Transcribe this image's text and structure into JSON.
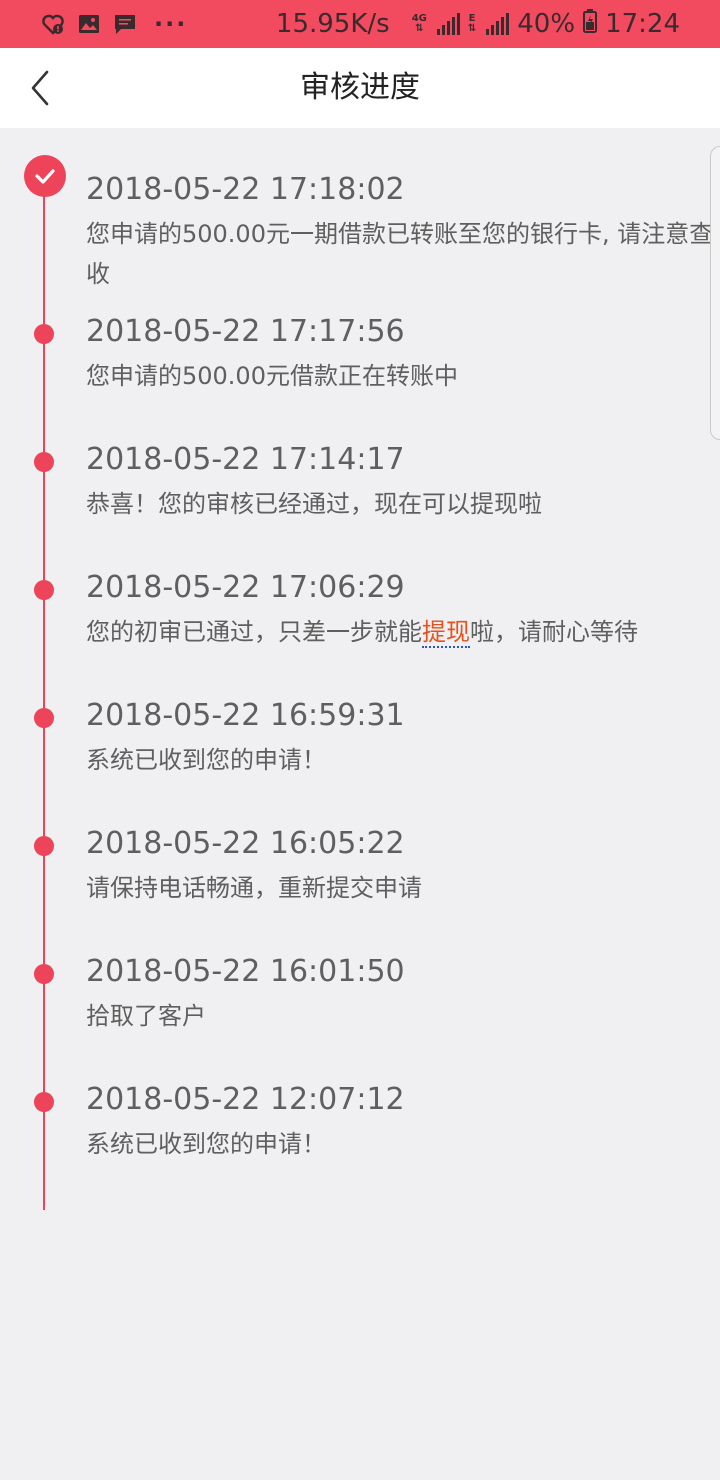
{
  "status_bar": {
    "net_speed": "15.95K/s",
    "net_label_1": "4G",
    "net_label_2": "E",
    "battery": "40%",
    "time": "17:24",
    "dots": "···"
  },
  "header": {
    "title": "审核进度",
    "back_icon": "chevron-left-icon"
  },
  "timeline": {
    "items": [
      {
        "time": "2018-05-22 17:18:02",
        "message": "您申请的500.00元一期借款已转账至您的银行卡, 请注意查收",
        "marker": "check"
      },
      {
        "time": "2018-05-22 17:17:56",
        "message": "您申请的500.00元借款正在转账中",
        "marker": "dot"
      },
      {
        "time": "2018-05-22 17:14:17",
        "message": "恭喜！您的审核已经通过，现在可以提现啦",
        "marker": "dot"
      },
      {
        "time": "2018-05-22 17:06:29",
        "message_before": "您的初审已通过，只差一步就能",
        "message_highlight": "提现",
        "message_after": "啦，请耐心等待",
        "marker": "dot"
      },
      {
        "time": "2018-05-22 16:59:31",
        "message": "系统已收到您的申请！",
        "marker": "dot"
      },
      {
        "time": "2018-05-22 16:05:22",
        "message": "请保持电话畅通，重新提交申请",
        "marker": "dot"
      },
      {
        "time": "2018-05-22 16:01:50",
        "message": "拾取了客户",
        "marker": "dot"
      },
      {
        "time": "2018-05-22 12:07:12",
        "message": "系统已收到您的申请！",
        "marker": "dot"
      }
    ]
  },
  "colors": {
    "accent": "#ee4459",
    "status_bar": "#f24a5e",
    "text": "#5f5f5f",
    "highlight": "#e8501c"
  }
}
